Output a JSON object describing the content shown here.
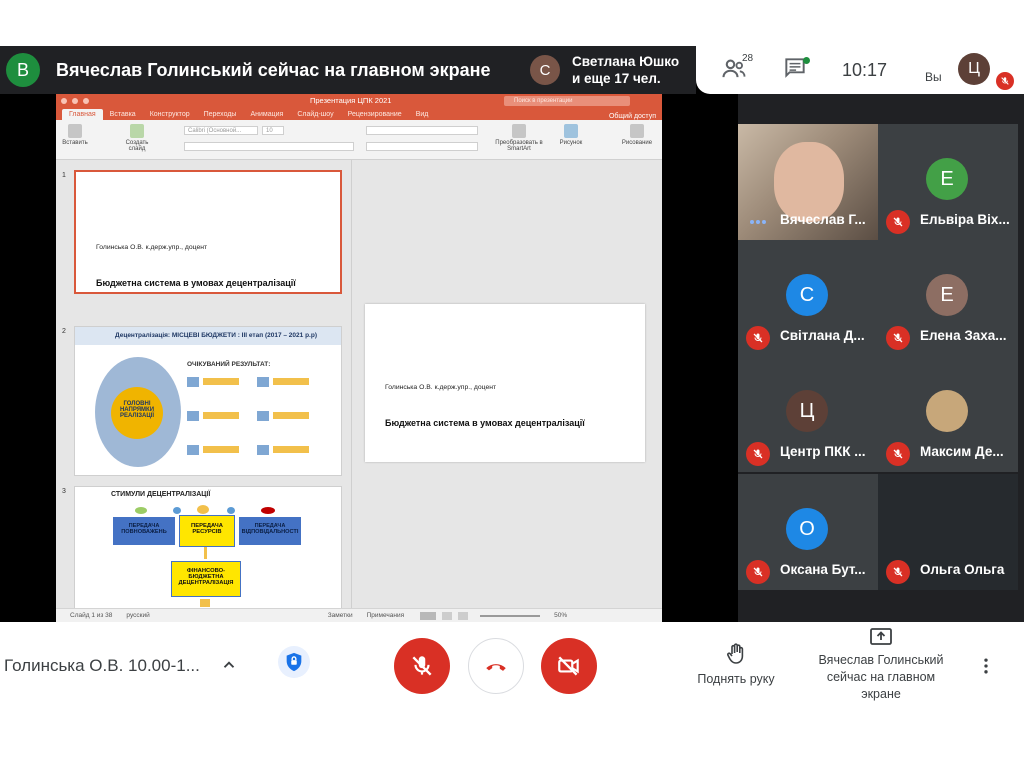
{
  "presenter": {
    "initial": "В",
    "title": "Вячеслав Голинський сейчас на главном экране"
  },
  "notification": {
    "initial": "С",
    "line1": "Светлана Юшко",
    "line2": "и еще 17 чел."
  },
  "topbar": {
    "people_count": "28",
    "time": "10:17",
    "you_label": "Вы",
    "self_initial": "Ц"
  },
  "ppt": {
    "window_title": "Презентация ЦПК 2021",
    "search_placeholder": "Поиск в презентации",
    "tabs": [
      "Главная",
      "Вставка",
      "Конструктор",
      "Переходы",
      "Анимация",
      "Слайд-шоу",
      "Рецензирование",
      "Вид"
    ],
    "share_label": "Общий доступ",
    "ribbon": {
      "paste": "Вставить",
      "new_slide": "Создать слайд",
      "font": "Calibri (Основной...",
      "font_size": "10",
      "smartart": "Преобразовать в SmartArt",
      "picture": "Рисунок",
      "drawing": "Рисование"
    },
    "slide1": {
      "num": "1",
      "author": "Голинська О.В. к.держ.упр., доцент",
      "title": "Бюджетна система в умовах децентралізації"
    },
    "slide2": {
      "num": "2",
      "heading": "Децентралізація: МІСЦЕВІ БЮДЖЕТИ : ІІІ етап (2017 – 2021 р.р)",
      "center": "ГОЛОВНІ НАПРЯМКИ РЕАЛІЗАЦІЇ",
      "result": "ОЧІКУВАНИЙ РЕЗУЛЬТАТ:"
    },
    "slide3": {
      "num": "3",
      "heading": "СТИМУЛИ ДЕЦЕНТРАЛІЗАЦІЇ",
      "box1": "ПЕРЕДАЧА ПОВНОВАЖЕНЬ",
      "box2": "ПЕРЕДАЧА РЕСУРСІВ",
      "box3": "ПЕРЕДАЧА ВІДПОВІДАЛЬНОСТІ",
      "box4": "ФІНАНСОВО-БЮДЖЕТНА ДЕЦЕНТРАЛІЗАЦІЯ"
    },
    "main_slide": {
      "author": "Голинська О.В. к.держ.упр., доцент",
      "title": "Бюджетна система в умовах децентралізації"
    },
    "status": {
      "slide_info": "Слайд 1 из 38",
      "language": "русский",
      "notes": "Заметки",
      "comments": "Примечания",
      "zoom": "50%"
    }
  },
  "participants": [
    {
      "name": "Вячеслав Г...",
      "initial": "",
      "color": "#8a7a6a",
      "video": true
    },
    {
      "name": "Ельвіра Віх...",
      "initial": "Е",
      "color": "#43a047",
      "video": false
    },
    {
      "name": "Світлана Д...",
      "initial": "С",
      "color": "#1e88e5",
      "video": false
    },
    {
      "name": "Елена Заха...",
      "initial": "Е",
      "color": "#8d6e63",
      "video": false
    },
    {
      "name": "Центр ПКК ...",
      "initial": "Ц",
      "color": "#5d4037",
      "video": false
    },
    {
      "name": "Максим Де...",
      "initial": "",
      "color": "#c7a77a",
      "video": false
    },
    {
      "name": "Оксана Бут...",
      "initial": "О",
      "color": "#1e88e5",
      "video": false
    },
    {
      "name": "Ольга Ольга",
      "initial": "",
      "color": "#2a2e33",
      "video": true
    }
  ],
  "bottom": {
    "meeting_name": "Голинська О.В. 10.00-1...",
    "raise_hand": "Поднять руку",
    "presenting": "Вячеслав Голинський сейчас на главном экране"
  },
  "colors": {
    "danger": "#d93025",
    "ppt_accent": "#d9583b",
    "stage": "#202124"
  }
}
